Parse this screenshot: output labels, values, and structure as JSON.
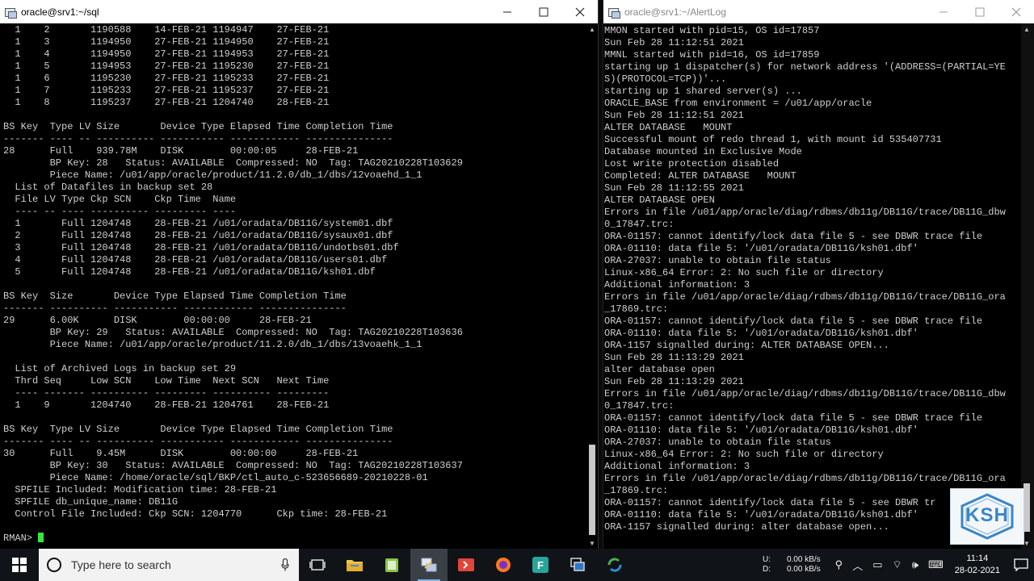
{
  "left_window": {
    "title": "oracle@srv1:~/sql",
    "prompt": "RMAN> ",
    "lines": [
      "  1    2       1190588    14-FEB-21 1194947    27-FEB-21",
      "  1    3       1194950    27-FEB-21 1194950    27-FEB-21",
      "  1    4       1194950    27-FEB-21 1194953    27-FEB-21",
      "  1    5       1194953    27-FEB-21 1195230    27-FEB-21",
      "  1    6       1195230    27-FEB-21 1195233    27-FEB-21",
      "  1    7       1195233    27-FEB-21 1195237    27-FEB-21",
      "  1    8       1195237    27-FEB-21 1204740    28-FEB-21",
      "",
      "BS Key  Type LV Size       Device Type Elapsed Time Completion Time",
      "------- ---- -- ---------- ----------- ------------ ---------------",
      "28      Full    939.78M    DISK        00:00:05     28-FEB-21",
      "        BP Key: 28   Status: AVAILABLE  Compressed: NO  Tag: TAG20210228T103629",
      "        Piece Name: /u01/app/oracle/product/11.2.0/db_1/dbs/12voaehd_1_1",
      "  List of Datafiles in backup set 28",
      "  File LV Type Ckp SCN    Ckp Time  Name",
      "  ---- -- ---- ---------- --------- ----",
      "  1       Full 1204748    28-FEB-21 /u01/oradata/DB11G/system01.dbf",
      "  2       Full 1204748    28-FEB-21 /u01/oradata/DB11G/sysaux01.dbf",
      "  3       Full 1204748    28-FEB-21 /u01/oradata/DB11G/undotbs01.dbf",
      "  4       Full 1204748    28-FEB-21 /u01/oradata/DB11G/users01.dbf",
      "  5       Full 1204748    28-FEB-21 /u01/oradata/DB11G/ksh01.dbf",
      "",
      "BS Key  Size       Device Type Elapsed Time Completion Time",
      "------- ---------- ----------- ------------ ---------------",
      "29      6.00K      DISK        00:00:00     28-FEB-21",
      "        BP Key: 29   Status: AVAILABLE  Compressed: NO  Tag: TAG20210228T103636",
      "        Piece Name: /u01/app/oracle/product/11.2.0/db_1/dbs/13voaehk_1_1",
      "",
      "  List of Archived Logs in backup set 29",
      "  Thrd Seq     Low SCN    Low Time  Next SCN   Next Time",
      "  ---- ------- ---------- --------- ---------- ---------",
      "  1    9       1204740    28-FEB-21 1204761    28-FEB-21",
      "",
      "BS Key  Type LV Size       Device Type Elapsed Time Completion Time",
      "------- ---- -- ---------- ----------- ------------ ---------------",
      "30      Full    9.45M      DISK        00:00:00     28-FEB-21",
      "        BP Key: 30   Status: AVAILABLE  Compressed: NO  Tag: TAG20210228T103637",
      "        Piece Name: /home/oracle/sql/BKP/ctl_auto_c-523656689-20210228-01",
      "  SPFILE Included: Modification time: 28-FEB-21",
      "  SPFILE db_unique_name: DB11G",
      "  Control File Included: Ckp SCN: 1204770      Ckp time: 28-FEB-21",
      ""
    ]
  },
  "right_window": {
    "title": "oracle@srv1:~/AlertLog",
    "lines": [
      "MMON started with pid=15, OS id=17857",
      "Sun Feb 28 11:12:51 2021",
      "MMNL started with pid=16, OS id=17859",
      "starting up 1 dispatcher(s) for network address '(ADDRESS=(PARTIAL=YE",
      "S)(PROTOCOL=TCP))'...",
      "starting up 1 shared server(s) ...",
      "ORACLE_BASE from environment = /u01/app/oracle",
      "Sun Feb 28 11:12:51 2021",
      "ALTER DATABASE   MOUNT",
      "Successful mount of redo thread 1, with mount id 535407731",
      "Database mounted in Exclusive Mode",
      "Lost write protection disabled",
      "Completed: ALTER DATABASE   MOUNT",
      "Sun Feb 28 11:12:55 2021",
      "ALTER DATABASE OPEN",
      "Errors in file /u01/app/oracle/diag/rdbms/db11g/DB11G/trace/DB11G_dbw",
      "0_17847.trc:",
      "ORA-01157: cannot identify/lock data file 5 - see DBWR trace file",
      "ORA-01110: data file 5: '/u01/oradata/DB11G/ksh01.dbf'",
      "ORA-27037: unable to obtain file status",
      "Linux-x86_64 Error: 2: No such file or directory",
      "Additional information: 3",
      "Errors in file /u01/app/oracle/diag/rdbms/db11g/DB11G/trace/DB11G_ora",
      "_17869.trc:",
      "ORA-01157: cannot identify/lock data file 5 - see DBWR trace file",
      "ORA-01110: data file 5: '/u01/oradata/DB11G/ksh01.dbf'",
      "ORA-1157 signalled during: ALTER DATABASE OPEN...",
      "Sun Feb 28 11:13:29 2021",
      "alter database open",
      "Sun Feb 28 11:13:29 2021",
      "Errors in file /u01/app/oracle/diag/rdbms/db11g/DB11G/trace/DB11G_dbw",
      "0_17847.trc:",
      "ORA-01157: cannot identify/lock data file 5 - see DBWR trace file",
      "ORA-01110: data file 5: '/u01/oradata/DB11G/ksh01.dbf'",
      "ORA-27037: unable to obtain file status",
      "Linux-x86_64 Error: 2: No such file or directory",
      "Additional information: 3",
      "Errors in file /u01/app/oracle/diag/rdbms/db11g/DB11G/trace/DB11G_ora",
      "_17869.trc:",
      "ORA-01157: cannot identify/lock data file 5 - see DBWR tr",
      "ORA-01110: data file 5: '/u01/oradata/DB11G/ksh01.dbf'",
      "ORA-1157 signalled during: alter database open...",
      ""
    ],
    "logo_text": "KSH"
  },
  "taskbar": {
    "search_placeholder": "Type here to search",
    "net_labels": [
      "U:",
      "D:"
    ],
    "net_values": [
      "0.00 kB/s",
      "0.00 kB/s"
    ],
    "time": "11:14",
    "date": "28-02-2021"
  },
  "colors": {
    "terminal_bg": "#000000",
    "terminal_text": "#cfcfcf",
    "cursor": "#3ce33c",
    "taskbar_bg": "#101318"
  }
}
